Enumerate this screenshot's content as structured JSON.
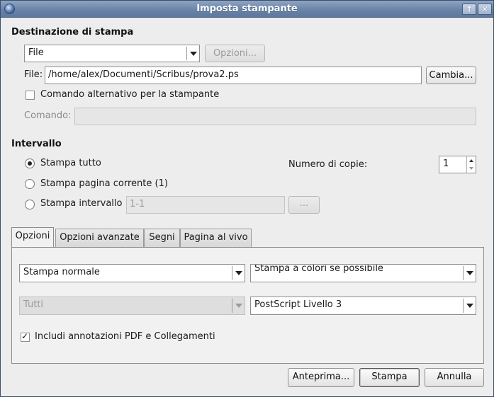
{
  "window": {
    "title": "Imposta stampante",
    "btn_up": "↑",
    "btn_close": "✕"
  },
  "destination": {
    "section_title": "Destinazione di stampa",
    "printer_value": "File",
    "options_button": "Opzioni...",
    "file_label": "File:",
    "file_value": "/home/alex/Documenti/Scribus/prova2.ps",
    "change_button": "Cambia...",
    "alt_command_label": "Comando alternativo per la stampante",
    "alt_command_checked": false,
    "command_label": "Comando:",
    "command_value": ""
  },
  "range": {
    "section_title": "Intervallo",
    "print_all": "Stampa tutto",
    "print_current": "Stampa pagina corrente (1)",
    "print_range": "Stampa intervallo",
    "range_value": "1-1",
    "range_button": "...",
    "selected": "print_all",
    "copies_label": "Numero di copie:",
    "copies_value": "1"
  },
  "tabs": [
    {
      "label": "Opzioni",
      "active": true
    },
    {
      "label": "Opzioni avanzate",
      "active": false
    },
    {
      "label": "Segni",
      "active": false
    },
    {
      "label": "Pagina al vivo",
      "active": false
    }
  ],
  "options": {
    "print_mode": "Stampa normale",
    "color_mode": "Stampa a colori se possibile",
    "separations": "Tutti",
    "postscript_level": "PostScript Livello 3",
    "pdf_annotations_label": "Includi annotazioni PDF e Collegamenti",
    "pdf_annotations_checked": true
  },
  "footer": {
    "preview_button": "Anteprima...",
    "print_button": "Stampa",
    "cancel_button": "Annulla"
  }
}
